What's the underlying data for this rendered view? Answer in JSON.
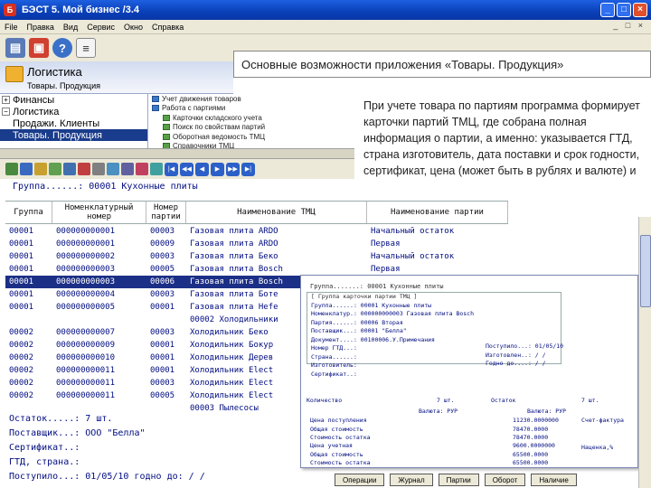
{
  "window": {
    "title": "БЭСТ 5. Мой бизнес /3.4"
  },
  "menu": [
    "File",
    "Правка",
    "Вид",
    "Сервис",
    "Окно",
    "Справка"
  ],
  "module": {
    "title": "Логистика",
    "subtitle": "Товары. Продукция"
  },
  "callout_top": "Основные возможности приложения «Товары. Продукция»",
  "callout_right": "При учете товара по партиям программа формирует карточки партий ТМЦ, где собрана полная информация о партии, а именно: указывается ГТД, страна изготовитель, дата поставки и срок годности, сертификат, цена (может быть в рублях и валюте) и т.д.",
  "tree": [
    {
      "label": "Финансы",
      "expander": "+",
      "level": 0,
      "selected": false
    },
    {
      "label": "Логистика",
      "expander": "−",
      "level": 0,
      "selected": false
    },
    {
      "label": "Продажи. Клиенты",
      "expander": "",
      "level": 1,
      "selected": false
    },
    {
      "label": "Товары. Продукция",
      "expander": "",
      "level": 1,
      "selected": true
    }
  ],
  "subtree": [
    {
      "label": "Учет движения товаров",
      "sub": false
    },
    {
      "label": "Работа с партиями",
      "sub": false
    },
    {
      "label": "Карточки складского учета",
      "sub": true
    },
    {
      "label": "Поиск по свойствам партий",
      "sub": true
    },
    {
      "label": "Оборотная ведомость ТМЦ",
      "sub": true
    },
    {
      "label": "Справочники ТМЦ",
      "sub": true
    }
  ],
  "console": {
    "group_line": "Группа......: 00001 Кухонные плиты",
    "headers": [
      "Группа",
      "Номенклатурный номер",
      "Номер партии",
      "Наименование ТМЦ",
      "Наименование партии"
    ],
    "rows": [
      [
        "00001",
        "000000000001",
        "00003",
        "Газовая плита ARDO",
        "Начальный остаток",
        false
      ],
      [
        "00001",
        "000000000001",
        "00009",
        "Газовая плита ARDO",
        "Первая",
        false
      ],
      [
        "00001",
        "000000000002",
        "00003",
        "Газовая плита Беко",
        "Начальный остаток",
        false
      ],
      [
        "00001",
        "000000000003",
        "00005",
        "Газовая плита Bosch",
        "Первая",
        false
      ],
      [
        "00001",
        "000000000003",
        "00006",
        "Газовая плита Bosch",
        "Вторая",
        true
      ],
      [
        "00001",
        "000000000004",
        "00003",
        "Газовая плита Боте",
        "",
        false
      ],
      [
        "00001",
        "000000000005",
        "00001",
        "Газовая плита Hefe",
        "",
        false
      ],
      [
        "",
        "",
        "",
        "00002 Холодильники",
        "",
        false
      ],
      [
        "00002",
        "000000000007",
        "00003",
        "Холодильник Беко",
        "",
        false
      ],
      [
        "00002",
        "000000000009",
        "00001",
        "Холодильник Бокур",
        "",
        false
      ],
      [
        "00002",
        "000000000010",
        "00001",
        "Холодильник Дерев",
        "",
        false
      ],
      [
        "00002",
        "000000000011",
        "00001",
        "Холодильник Elect",
        "",
        false
      ],
      [
        "00002",
        "000000000011",
        "00003",
        "Холодильник Elect",
        "",
        false
      ],
      [
        "00002",
        "000000000011",
        "00005",
        "Холодильник Elect",
        "",
        false
      ],
      [
        "",
        "",
        "",
        "00003 Пылесосы",
        "",
        false
      ]
    ]
  },
  "card": {
    "title": "Группа.......: 00001  Кухонные плиты",
    "box_title": "[ Группа карточки партии ТМЦ ]",
    "lines": [
      "Группа......: 00001 Кухонные плиты",
      "Номенклатур.: 000000000003 Газовая плита Bosch",
      "Партия......: 00006 Вторая",
      "Поставщик...: 00001 \"Белла\"",
      "Документ....: 00100006.У.Примечания",
      "Номер ГТД...:",
      "Страна......:",
      "Изготовитель:",
      "Сертификат..:"
    ],
    "right_lines": [
      "Поступило...: 01/05/10",
      "Изготовлен..: / /",
      "Годно до....: / /"
    ],
    "qty_label": "Количество",
    "qty_value": "7 шт.",
    "rest_label": "Остаток",
    "rest_value": "7 шт.",
    "currency1": "Валюта: РУР",
    "currency2": "Валюта: РУР",
    "price_lines": [
      "Цена поступления  11230.0000000",
      "Общая стоимость    78470.0000",
      "Стоимость остатка  78470.0000"
    ],
    "price_lines2": [
      "11230.0000000",
      "78470.0000",
      "78470.0000"
    ],
    "sales_lines": [
      "Цена учетная    9600.0000000",
      "Общая стоимость  65500.0000",
      "Стоимость остатка 65500.0000"
    ],
    "sales_lines2": [
      "9600.0000000",
      "65500.0000",
      "65500.0000"
    ],
    "side_lines": [
      "Счет-фактура",
      "Наценка,%"
    ]
  },
  "bottom": [
    "Остаток.....:      7 шт.",
    "Поставщик...: ООО \"Белла\"",
    "Сертификат..:",
    "ГТД, страна.:",
    "Поступило...: 01/05/10 годно до:  / /"
  ],
  "footer_buttons": [
    "Операции",
    "Журнал",
    "Партии",
    "Оборот",
    "Наличие"
  ],
  "colors": {
    "titlebar": "#0a3fb8",
    "selection": "#1c2f86",
    "console_text": "#000c80"
  }
}
